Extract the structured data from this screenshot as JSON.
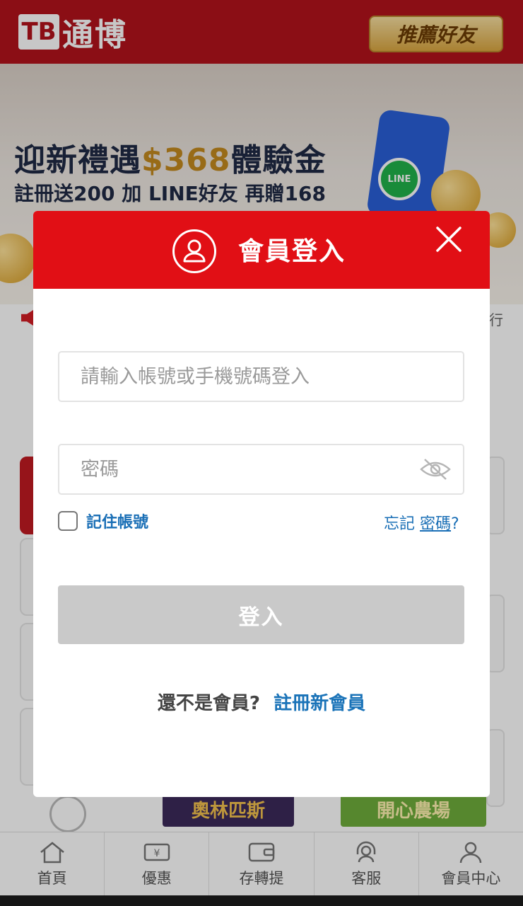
{
  "header": {
    "logo_mark": "TB",
    "logo_text": "通博",
    "refer_label": "推薦好友"
  },
  "banner": {
    "line1_prefix": "迎新禮遇",
    "line1_amount": "$368",
    "line1_suffix": "體驗金",
    "line2": "註冊送200 加 LINE好友 再贈168",
    "line_badge": "LINE"
  },
  "notice": {
    "tail_text": "行"
  },
  "games": [
    {
      "label": "奧林匹斯",
      "bg": "#3b2a5a",
      "color": "#f2c14e"
    },
    {
      "label": "開心農場",
      "bg": "#6fae3c",
      "color": "#fff3b0"
    }
  ],
  "bottom_nav": [
    {
      "label": "首頁",
      "icon": "home-icon"
    },
    {
      "label": "優惠",
      "icon": "coupon-icon"
    },
    {
      "label": "存轉提",
      "icon": "wallet-icon"
    },
    {
      "label": "客服",
      "icon": "headset-icon"
    },
    {
      "label": "會員中心",
      "icon": "member-icon"
    }
  ],
  "login_modal": {
    "title": "會員登入",
    "account_placeholder": "請輸入帳號或手機號碼登入",
    "account_value": "",
    "password_placeholder": "密碼",
    "password_value": "",
    "remember_label": "記住帳號",
    "remember_checked": false,
    "forgot_prefix": "忘記",
    "forgot_link": "密碼",
    "forgot_suffix": "?",
    "login_label": "登入",
    "register_question": "還不是會員?",
    "register_link": "註冊新會員"
  },
  "colors": {
    "brand_red": "#e10f15",
    "topbar_red": "#b3121b",
    "link_blue": "#1a73b8",
    "disabled_button": "#c9c9c9"
  }
}
